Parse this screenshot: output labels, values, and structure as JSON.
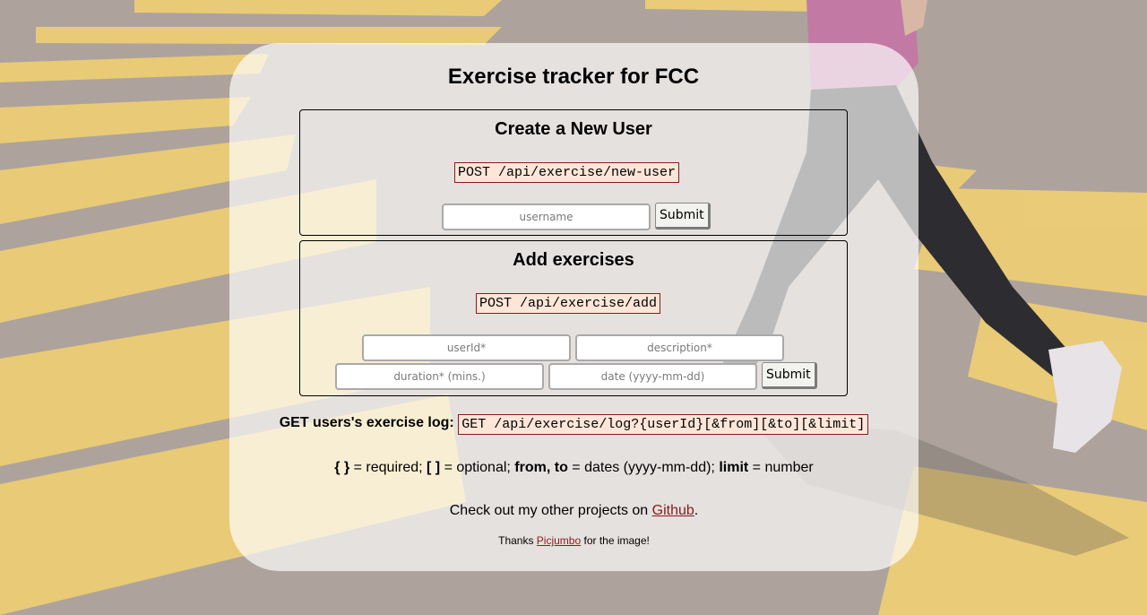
{
  "page": {
    "title": "Exercise tracker for FCC"
  },
  "create_user": {
    "heading": "Create a New User",
    "endpoint": "POST /api/exercise/new-user",
    "username_placeholder": "username",
    "submit_label": "Submit"
  },
  "add_exercise": {
    "heading": "Add exercises",
    "endpoint": "POST /api/exercise/add",
    "userid_placeholder": "userId*",
    "description_placeholder": "description*",
    "duration_placeholder": "duration* (mins.)",
    "date_placeholder": "date (yyyy-mm-dd)",
    "submit_label": "Submit"
  },
  "log": {
    "label": "GET users's exercise log:",
    "endpoint": "GET /api/exercise/log?{userId}[&from][&to][&limit]"
  },
  "legend": {
    "required_symbol": "{ }",
    "required_text": " = required; ",
    "optional_symbol": "[ ]",
    "optional_text": " = optional; ",
    "dates_symbol": "from, to",
    "dates_text": " = dates (yyyy-mm-dd); ",
    "limit_symbol": "limit",
    "limit_text": " = number"
  },
  "footer": {
    "projects_prefix": "Check out my other projects on ",
    "github_link": "Github",
    "projects_suffix": ".",
    "thanks_prefix": "Thanks ",
    "picjumbo_link": "Picjumbo",
    "thanks_suffix": " for the image!"
  },
  "colors": {
    "code_background": "#fde6d8",
    "code_border": "#8b1a1a",
    "link": "#8b1a1a",
    "crosswalk": "#f7d25a",
    "asphalt": "#a89e98"
  }
}
